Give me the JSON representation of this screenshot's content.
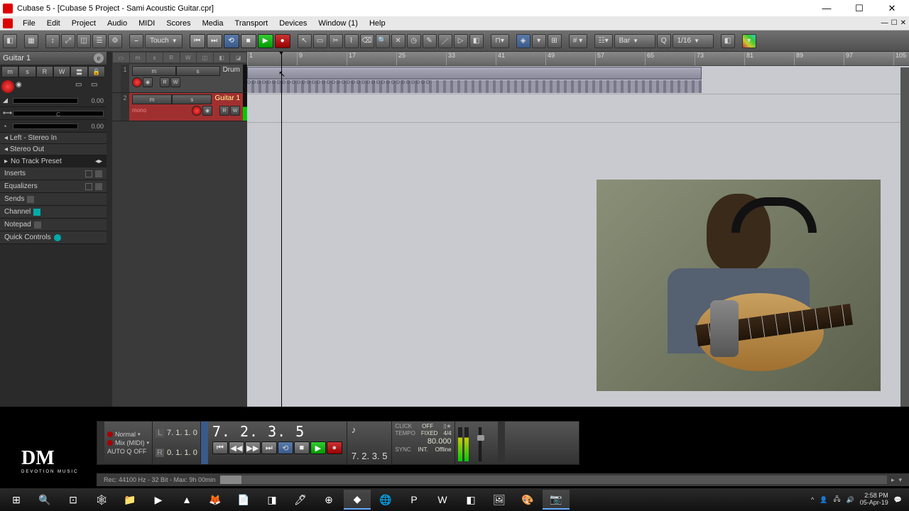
{
  "window": {
    "title": "Cubase 5 - [Cubase 5 Project - Sami Acoustic Guitar.cpr]"
  },
  "menu": [
    "File",
    "Edit",
    "Project",
    "Audio",
    "MIDI",
    "Scores",
    "Media",
    "Transport",
    "Devices",
    "Window (1)",
    "Help"
  ],
  "toolbar": {
    "automation_mode": "Touch",
    "grid_type": "Bar",
    "quantize": "1/16"
  },
  "inspector": {
    "track_name": "Guitar 1",
    "strip_buttons": [
      "m",
      "s",
      "R",
      "W",
      "〓",
      "🔒"
    ],
    "vol": "0.00",
    "pan": "0.00",
    "pan_label": "C",
    "input": "Left - Stereo In",
    "output": "Stereo Out",
    "preset": "No Track Preset",
    "sections": [
      "Inserts",
      "Equalizers",
      "Sends",
      "Channel",
      "Notepad",
      "Quick Controls"
    ]
  },
  "tracks": [
    {
      "num": "1",
      "name": "Drum",
      "mono": "",
      "selected": false
    },
    {
      "num": "2",
      "name": "Guitar 1",
      "mono": "mono",
      "selected": true
    }
  ],
  "ruler_marks": [
    1,
    9,
    17,
    25,
    33,
    41,
    49,
    57,
    65,
    73,
    81,
    89,
    97,
    105
  ],
  "transport": {
    "mode1": "Normal",
    "mode2": "Mix (MIDI)",
    "auto_q": "AUTO Q",
    "auto_q_state": "OFF",
    "locL": "7. 1. 1.   0",
    "locR": "0. 1. 1.   0",
    "main_time": "7. 2. 3.   5",
    "sub_time": "7. 2. 3.   5",
    "click": "CLICK",
    "click_v": "OFF",
    "tempo": "TEMPO",
    "tempo_v": "FIXED",
    "sig": "4/4",
    "bpm": "80.000",
    "sync": "SYNC",
    "sync_v": "INT.",
    "offline": "Offline"
  },
  "status": "Rec: 44100 Hz - 32 Bit - Max: 9h 00min",
  "taskbar": {
    "time": "2:58 PM",
    "date": "05-Apr-19"
  }
}
